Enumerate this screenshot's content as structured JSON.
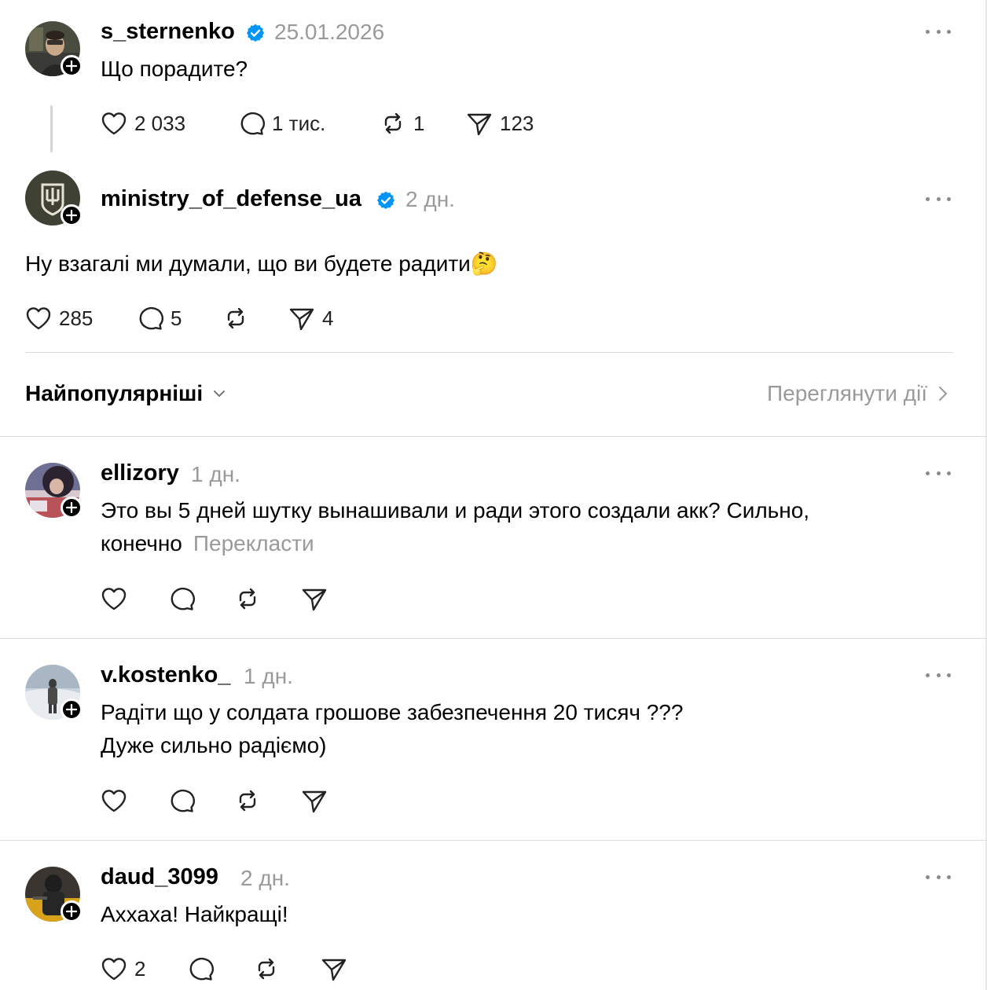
{
  "posts": [
    {
      "username": "s_sternenko",
      "verified": true,
      "time": "25.01.2026",
      "text": "Що порадите?",
      "stats": {
        "likes": "2 033",
        "replies": "1 тис.",
        "reposts": "1",
        "shares": "123"
      }
    },
    {
      "username": "ministry_of_defense_ua",
      "verified": true,
      "time": "2 дн.",
      "text": "Ну взагалі ми думали, що ви будете радити🤔",
      "stats": {
        "likes": "285",
        "replies": "5",
        "reposts": "",
        "shares": "4"
      }
    }
  ],
  "sort": {
    "label": "Найпопулярніші",
    "view_activity": "Переглянути дії"
  },
  "comments": [
    {
      "username": "ellizory",
      "time": "1 дн.",
      "text_line1": "Это вы 5 дней шутку вынашивали и ради этого создали акк? Сильно,",
      "text_line2": "конечно",
      "translate": "Перекласти"
    },
    {
      "username": "v.kostenko_",
      "time": "1 дн.",
      "text_line1": "Радіти що у солдата грошове забезпечення 20 тисяч ???",
      "text_line2": "Дуже сильно радіємо)"
    },
    {
      "username": "daud_3099",
      "time": "2 дн.",
      "text_line1": "Аххаха! Найкращі!",
      "likes": "2"
    }
  ],
  "colors": {
    "verified": "#0095f6",
    "muted": "#9a9a9a",
    "divider": "#dcdcdc"
  }
}
